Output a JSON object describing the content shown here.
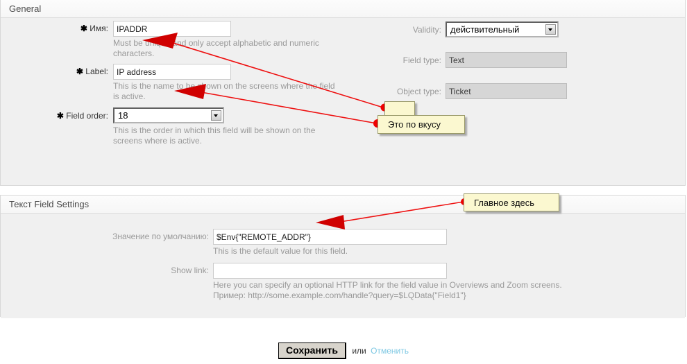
{
  "sections": {
    "general": {
      "title": "General",
      "left_fields": [
        {
          "label": "Имя:",
          "required": true,
          "control": "text",
          "value": "IPADDR",
          "placeholder": "",
          "hint": "Must be unique and only accept alphabetic and numeric characters."
        },
        {
          "label": "Label:",
          "required": true,
          "control": "text",
          "value": "IP address",
          "placeholder": "",
          "hint": "This is the name to be shown on the screens where the field is active."
        },
        {
          "label": "Field order:",
          "required": true,
          "control": "select",
          "value": "18",
          "hint": "This is the order in which this field will be shown on the screens where is active."
        }
      ],
      "right_fields": [
        {
          "label": "Validity:",
          "required": false,
          "control": "select",
          "value": "действительный",
          "hint": ""
        },
        {
          "label": "Field type:",
          "required": false,
          "control": "readonly",
          "value": "Text",
          "hint": ""
        },
        {
          "label": "Object type:",
          "required": false,
          "control": "readonly",
          "value": "Ticket",
          "hint": ""
        }
      ]
    },
    "text_field_settings": {
      "title": "Текст Field Settings",
      "fields": [
        {
          "label": "Значение по умолчанию:",
          "control": "text",
          "value": "$Env{\"REMOTE_ADDR\"}",
          "placeholder": "",
          "hint": "This is the default value for this field."
        },
        {
          "label": "Show link:",
          "control": "text",
          "value": "",
          "placeholder": "",
          "hint": "Here you can specify an optional HTTP link for the field value in Overviews and Zoom screens.",
          "hint2": "Пример: http://some.example.com/handle?query=$LQData{\"Field1\"}"
        }
      ]
    }
  },
  "submit": {
    "save_label": "Сохранить",
    "or_label": "или",
    "cancel_label": "Отменить"
  },
  "annotations": {
    "callout_taste": "Это по вкусу",
    "callout_taste_back": "",
    "callout_main": "Главное здесь",
    "accent_color": "#ee1111",
    "callout_bg": "#fbf8d0"
  }
}
